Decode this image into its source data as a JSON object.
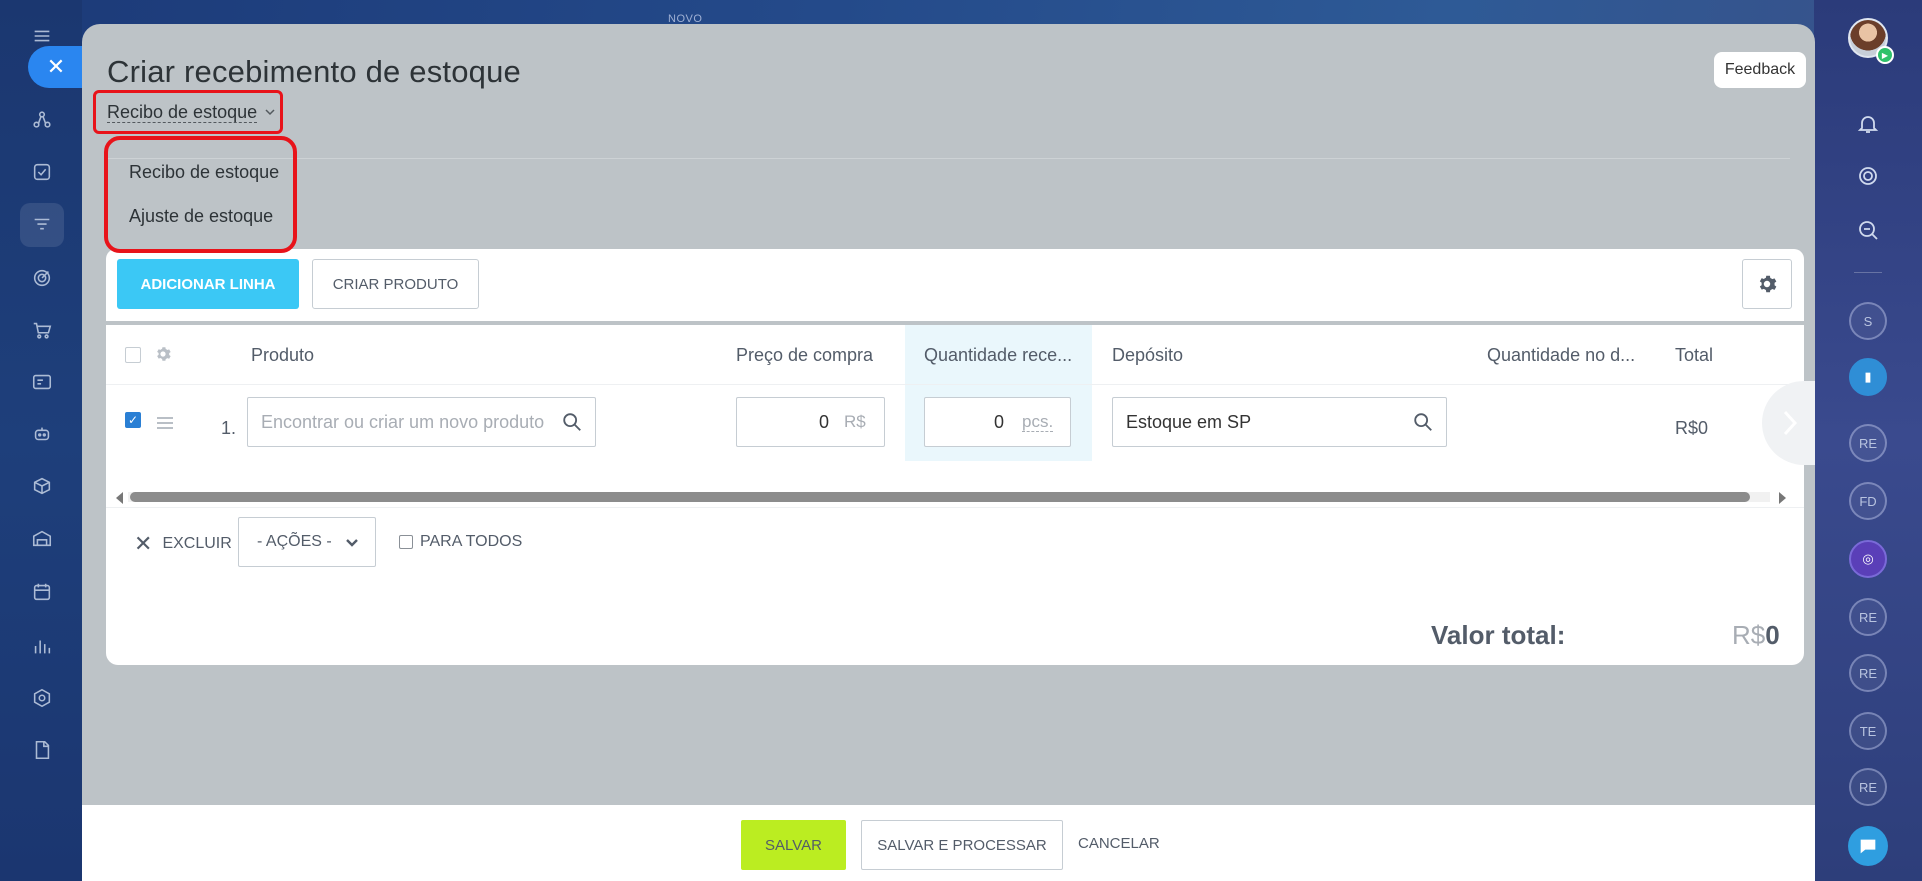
{
  "top_label": "NOVO",
  "panel": {
    "title": "Criar recebimento de estoque",
    "type_selector": "Recibo de estoque",
    "feedback": "Feedback"
  },
  "dropdown": {
    "items": [
      "Recibo de estoque",
      "Ajuste de estoque"
    ]
  },
  "toolbar": {
    "add_line": "ADICIONAR LINHA",
    "create_product": "CRIAR PRODUTO"
  },
  "grid": {
    "columns": {
      "product": "Produto",
      "price": "Preço de compra",
      "qty_received": "Quantidade rece...",
      "warehouse": "Depósito",
      "qty_in_stock": "Quantidade no d...",
      "total": "Total"
    },
    "rows": [
      {
        "num": "1.",
        "product_placeholder": "Encontrar ou criar um novo produto",
        "price": "0",
        "currency": "R$",
        "qty": "0",
        "unit": "pcs.",
        "warehouse": "Estoque em SP",
        "total": "R$0"
      }
    ]
  },
  "actions": {
    "delete": "EXCLUIR",
    "actions_select": "- AÇÕES -",
    "for_all": "PARA TODOS"
  },
  "summary": {
    "label": "Valor total:",
    "currency": "R$",
    "value": "0"
  },
  "footer": {
    "save": "SALVAR",
    "save_process": "SALVAR E PROCESSAR",
    "cancel": "CANCELAR"
  },
  "right_bar": {
    "avatars": [
      "S",
      "RE",
      "FD",
      "RE",
      "RE",
      "TE",
      "RE"
    ]
  },
  "colors": {
    "accent_blue": "#3bc8f5",
    "save_green": "#bbed21",
    "highlight_red": "#e8131a",
    "close_blue": "#2a86f0"
  }
}
